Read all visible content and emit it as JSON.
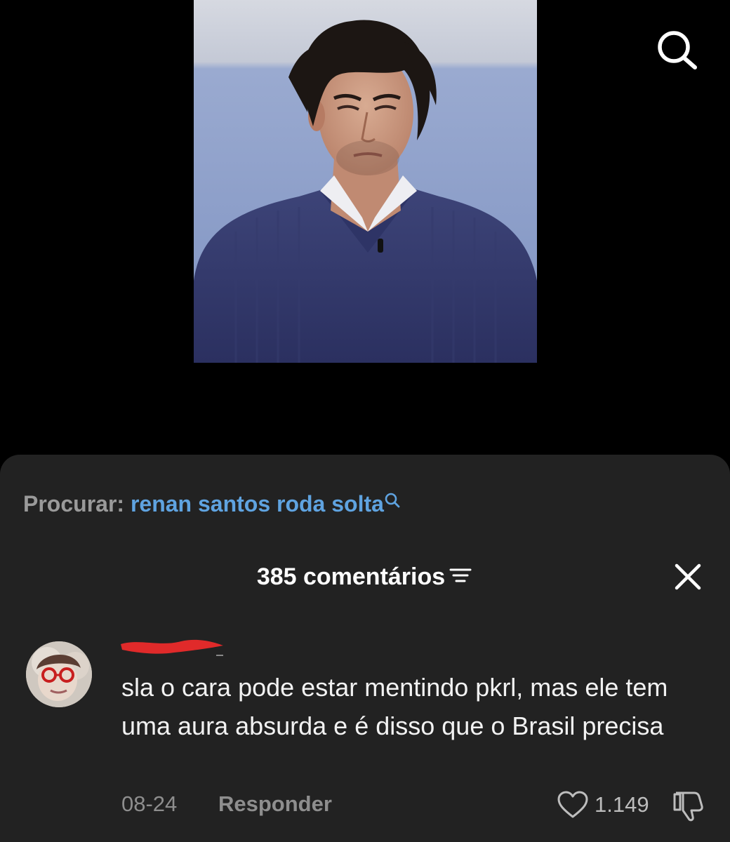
{
  "header": {
    "search_icon": "search-icon"
  },
  "video": {
    "description_icon": "person-video-thumbnail"
  },
  "search_suggestion": {
    "label": "Procurar:",
    "query": "renan santos roda solta",
    "icon": "search-small-icon",
    "link_color": "#5fa3e0"
  },
  "comments": {
    "count_title": "385 comentários",
    "sort_icon": "sort-icon",
    "close_icon": "close-icon",
    "items": [
      {
        "text": "sla o cara pode estar mentindo pkrl, mas ele tem uma aura absurda e é disso que o Brasil precisa",
        "date": "08-24",
        "reply_label": "Responder",
        "likes": "1.149",
        "like_icon": "heart-icon",
        "dislike_icon": "thumbs-down-icon"
      }
    ]
  },
  "colors": {
    "background": "#000000",
    "sheet": "#222222",
    "muted_text": "#8e8e8e",
    "redaction": "#e02a2a"
  }
}
